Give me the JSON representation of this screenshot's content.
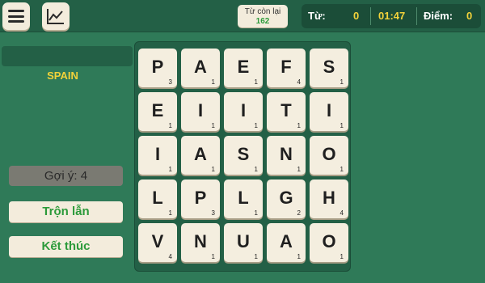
{
  "header": {
    "menu_icon": "hamburger-menu-icon",
    "stats_icon": "line-chart-icon",
    "remaining_label": "Từ còn lại",
    "remaining_value": "162",
    "words_label": "Từ:",
    "words_value": "0",
    "timer": "01:47",
    "score_label": "Điểm:",
    "score_value": "0"
  },
  "sidebar": {
    "current_word": "",
    "found_word": "SPAIN",
    "hint_label": "Gợi ý: 4",
    "shuffle_label": "Trộn lẫn",
    "finish_label": "Kết thúc"
  },
  "board": {
    "rows": [
      [
        {
          "letter": "P",
          "points": "3"
        },
        {
          "letter": "A",
          "points": "1"
        },
        {
          "letter": "E",
          "points": "1"
        },
        {
          "letter": "F",
          "points": "4"
        },
        {
          "letter": "S",
          "points": "1"
        }
      ],
      [
        {
          "letter": "E",
          "points": "1"
        },
        {
          "letter": "I",
          "points": "1"
        },
        {
          "letter": "I",
          "points": "1"
        },
        {
          "letter": "T",
          "points": "1"
        },
        {
          "letter": "I",
          "points": "1"
        }
      ],
      [
        {
          "letter": "I",
          "points": "1"
        },
        {
          "letter": "A",
          "points": "1"
        },
        {
          "letter": "S",
          "points": "1"
        },
        {
          "letter": "N",
          "points": "1"
        },
        {
          "letter": "O",
          "points": "1"
        }
      ],
      [
        {
          "letter": "L",
          "points": "1"
        },
        {
          "letter": "P",
          "points": "3"
        },
        {
          "letter": "L",
          "points": "1"
        },
        {
          "letter": "G",
          "points": "2"
        },
        {
          "letter": "H",
          "points": "4"
        }
      ],
      [
        {
          "letter": "V",
          "points": "4"
        },
        {
          "letter": "N",
          "points": "1"
        },
        {
          "letter": "U",
          "points": "1"
        },
        {
          "letter": "A",
          "points": "1"
        },
        {
          "letter": "O",
          "points": "1"
        }
      ]
    ]
  },
  "colors": {
    "background": "#2f7a58",
    "accent": "#f2d23a",
    "button_text": "#2b9a3a"
  }
}
